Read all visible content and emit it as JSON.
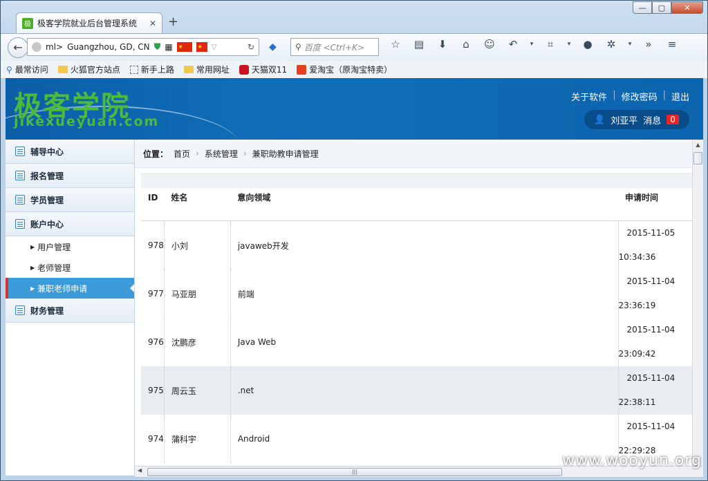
{
  "browser": {
    "tab_title": "极客学院就业后台管理系统",
    "tab_favicon": "极",
    "new_tab": "+",
    "url_text": "ml>",
    "location": "Guangzhou, GD, CN",
    "search_placeholder": "百度 <Ctrl+K>",
    "bookmarks": [
      "最常访问",
      "火狐官方站点",
      "新手上路",
      "常用网址",
      "天猫双11",
      "爱淘宝（原淘宝特卖）"
    ],
    "window_buttons": [
      "—",
      "▢",
      "✕"
    ]
  },
  "header": {
    "logo_cn": "极客学院",
    "logo_en": "jikexueyuan.com",
    "links": [
      "关于软件",
      "修改密码",
      "退出"
    ],
    "user": "刘亚平",
    "msg_label": "消息",
    "msg_count": "0"
  },
  "sidebar": {
    "groups": [
      "辅导中心",
      "报名管理",
      "学员管理",
      "账户中心",
      "财务管理"
    ],
    "sub_items": [
      "用户管理",
      "老师管理",
      "兼职老师申请"
    ]
  },
  "breadcrumb": {
    "label": "位置：",
    "items": [
      "首页",
      "系统管理",
      "兼职助教申请管理"
    ]
  },
  "table": {
    "headers": [
      "ID",
      "姓名",
      "意向领域",
      "申请时间"
    ],
    "rows": [
      {
        "id": "978",
        "name": "小刘",
        "field": "javaweb开发",
        "date": "2015-11-05",
        "time": "10:34:36"
      },
      {
        "id": "977",
        "name": "马亚朋",
        "field": "前端",
        "date": "2015-11-04",
        "time": "23:36:19"
      },
      {
        "id": "976",
        "name": "沈鹏彦",
        "field": "Java Web",
        "date": "2015-11-04",
        "time": "23:09:42"
      },
      {
        "id": "975",
        "name": "周云玉",
        "field": ".net",
        "date": "2015-11-04",
        "time": "22:38:11"
      },
      {
        "id": "974",
        "name": "蒲科宇",
        "field": "Android",
        "date": "2015-11-04",
        "time": "22:29:28"
      }
    ]
  },
  "watermark": "www.wooyun.org"
}
